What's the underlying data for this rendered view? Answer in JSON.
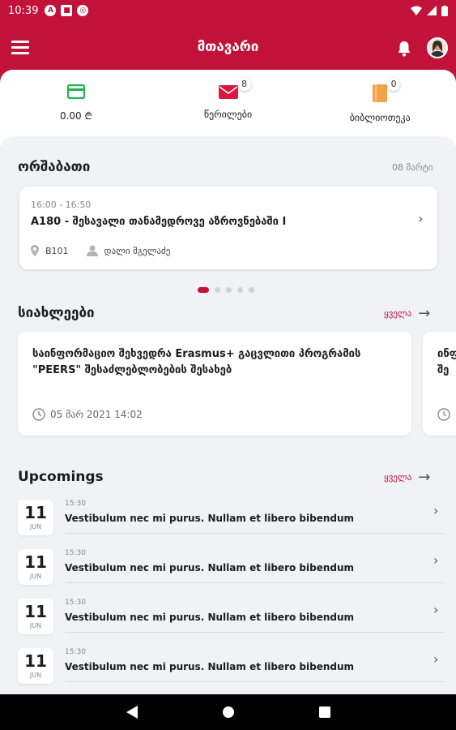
{
  "status_bar": {
    "time": "10:39"
  },
  "app_bar": {
    "title": "მთავარი"
  },
  "summary": [
    {
      "label": "0.00 ₾",
      "icon": "card-icon",
      "color": "#22b14c"
    },
    {
      "label": "წერილები",
      "icon": "mail-icon",
      "color": "#d8183f",
      "badge": "8"
    },
    {
      "label": "ბიბლიოთეკა",
      "icon": "book-icon",
      "color": "#f4a24a",
      "badge": "0"
    }
  ],
  "schedule": {
    "title": "ორშაბათი",
    "date": "08 მარტი",
    "card": {
      "time": "16:00 - 16:50",
      "name": "A180 - შესავალი თანამედროვე აზროვნებაში I",
      "room": "B101",
      "lecturer": "დალი მგელაძე"
    }
  },
  "news": {
    "title": "სიახლეები",
    "see_all": "ყველა",
    "items": [
      {
        "title": "საინფორმაციო შეხვედრა Erasmus+ გაცვლითი პროგრამის \"PEERS\" შესაძლებლობების შესახებ",
        "date": "05 მარ 2021 14:02"
      },
      {
        "title": "ინფ\nშე",
        "date": ""
      }
    ]
  },
  "upcomings": {
    "title": "Upcomings",
    "see_all": "ყველა",
    "items": [
      {
        "day": "11",
        "month": "JUN",
        "time": "15:30",
        "title": "Vestibulum nec mi purus. Nullam et libero bibendum"
      },
      {
        "day": "11",
        "month": "JUN",
        "time": "15:30",
        "title": "Vestibulum nec mi purus. Nullam et libero bibendum"
      },
      {
        "day": "11",
        "month": "JUN",
        "time": "15:30",
        "title": "Vestibulum nec mi purus. Nullam et libero bibendum"
      },
      {
        "day": "11",
        "month": "JUN",
        "time": "15:30",
        "title": "Vestibulum nec mi purus. Nullam et libero bibendum"
      }
    ]
  },
  "colors": {
    "brand": "#c2123a",
    "background": "#f0f2f5"
  }
}
